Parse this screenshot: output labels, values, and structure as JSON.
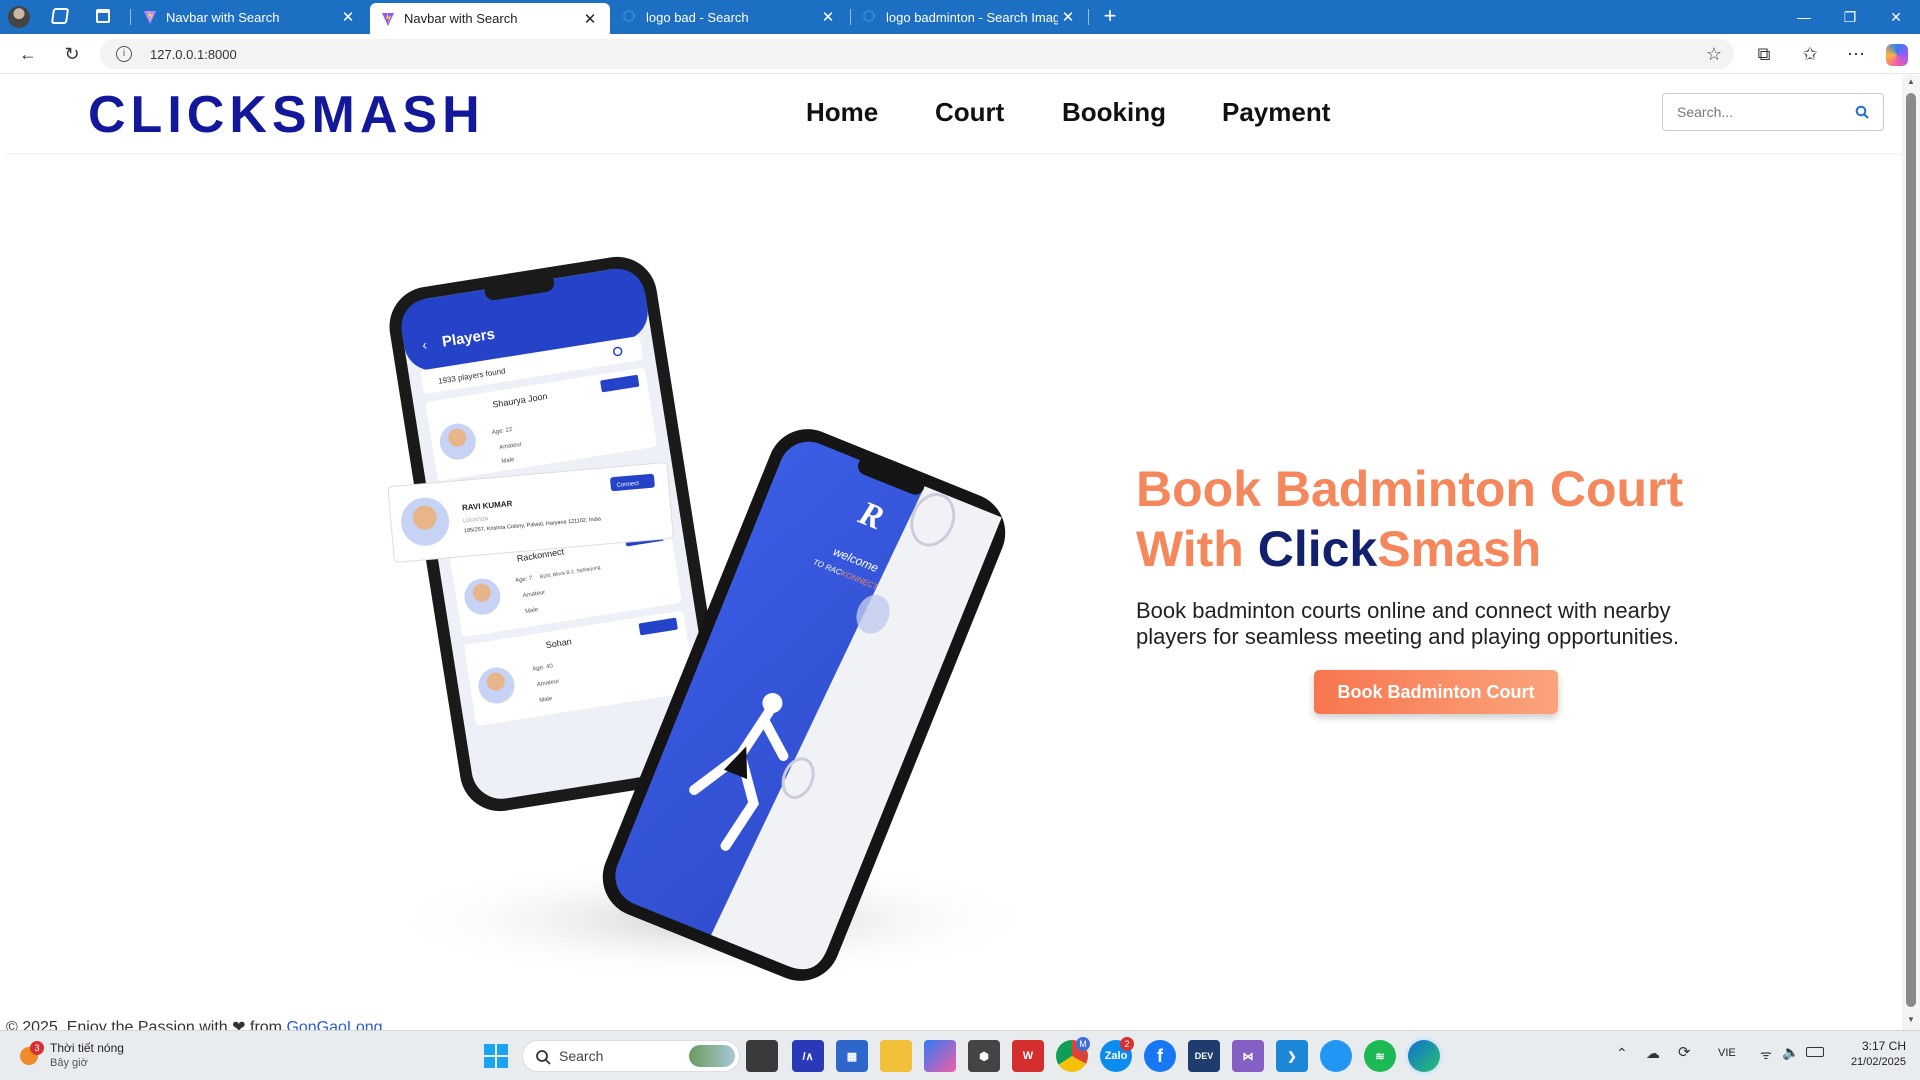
{
  "browser": {
    "tabs": [
      {
        "title": "Navbar with Search",
        "active": false
      },
      {
        "title": "Navbar with Search",
        "active": true
      },
      {
        "title": "logo bad - Search",
        "active": false
      },
      {
        "title": "logo badminton - Search Images",
        "active": false
      }
    ],
    "url": "127.0.0.1:8000"
  },
  "site": {
    "brand": "CLICKSMASH",
    "nav": [
      "Home",
      "Court",
      "Booking",
      "Payment"
    ],
    "search_placeholder": "Search...",
    "hero": {
      "title_line1": "Book Badminton Court",
      "title_with": "With ",
      "title_click": "Click",
      "title_smash": "Smash",
      "description": "Book badminton courts online and connect with nearby players for seamless meeting and playing opportunities.",
      "cta": "Book Badminton Court"
    },
    "phone_a": {
      "header": "Players",
      "found": "1933 players found",
      "cards": [
        {
          "name": "Shaurya Joon",
          "age": "Age: 22",
          "level": "Amateur",
          "score": "100",
          "gender": "Male"
        },
        {
          "name": "Rackonnect",
          "age": "Age: 7",
          "location": "B2/8, Block B 2, Safdarjung",
          "level": "Amateur",
          "score": "100",
          "gender": "Male"
        },
        {
          "name": "Sohan",
          "age": "Age: 40",
          "level": "Amateur",
          "score": "100",
          "gender": "Male"
        }
      ],
      "connect": "Connect",
      "popup": {
        "name": "RAVI KUMAR",
        "loc_label": "LOCATION",
        "address": "185/257, Krishna Colony, Palwal, Haryana 121102, India",
        "connect": "Connect"
      }
    },
    "phone_b": {
      "welcome": "welcome",
      "to": "TO RAC",
      "brand": "KONNECT"
    },
    "footer": {
      "text": "© 2025, Enjoy the Passion with ❤ from ",
      "link": "GonGaoLong"
    }
  },
  "taskbar": {
    "weather_title": "Thời tiết nóng",
    "weather_sub": "Bây giờ",
    "weather_badge": "3",
    "search": "Search",
    "lang": "VIE",
    "time": "3:17 CH",
    "date": "21/02/2025",
    "zalo_badge": "2",
    "chrome_badge": "M"
  },
  "colors": {
    "brand": "#13179a",
    "accent": "#f4875c",
    "tabbar": "#1d6fc4"
  }
}
